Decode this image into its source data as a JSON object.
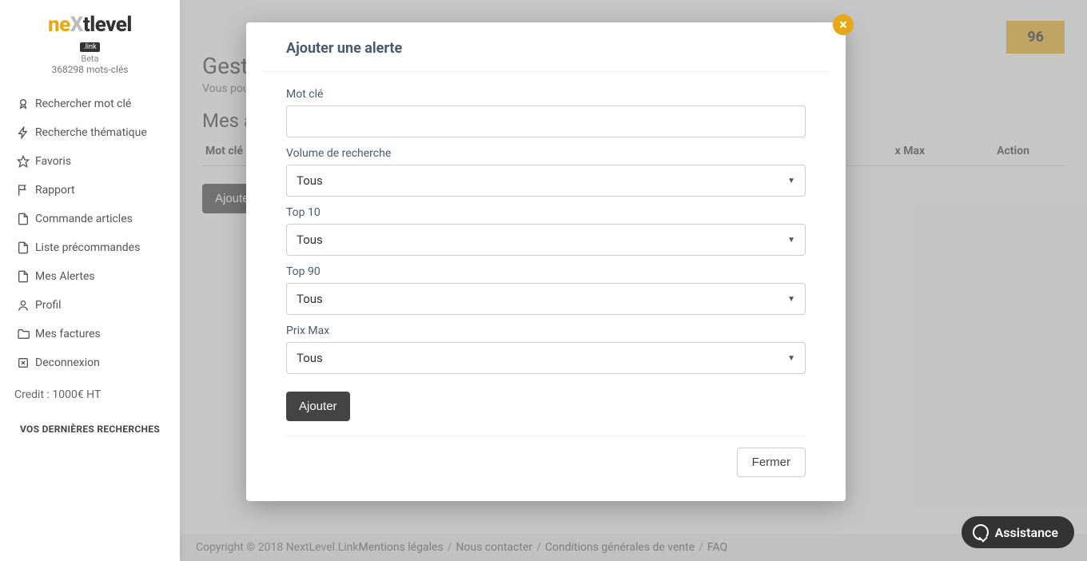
{
  "logo": {
    "part1": "ne",
    "x": "X",
    "part2": "tlevel",
    "sub": ".link"
  },
  "beta": "Beta",
  "keyword_count": "368298 mots-clés",
  "sidebar": {
    "items": [
      {
        "label": "Rechercher mot clé",
        "icon": "medal-icon"
      },
      {
        "label": "Recherche thématique",
        "icon": "bolt-icon"
      },
      {
        "label": "Favoris",
        "icon": "star-icon"
      },
      {
        "label": "Rapport",
        "icon": "flag-icon"
      },
      {
        "label": "Commande articles",
        "icon": "file-icon"
      },
      {
        "label": "Liste précommandes",
        "icon": "file-icon"
      },
      {
        "label": "Mes Alertes",
        "icon": "file-icon"
      },
      {
        "label": "Profil",
        "icon": "user-icon"
      },
      {
        "label": "Mes factures",
        "icon": "folder-icon"
      },
      {
        "label": "Deconnexion",
        "icon": "logout-icon"
      }
    ],
    "credit": "Credit : 1000€ HT",
    "recent_title": "VOS DERNIÈRES RECHERCHES"
  },
  "banner_right": "96",
  "page": {
    "title": "Gest",
    "sub": "Vous pouv",
    "alerts_title": "Mes a"
  },
  "table": {
    "col1": "Mot clé",
    "col_prixmax": "x Max",
    "col_action": "Action"
  },
  "add_button": "Ajouter",
  "modal": {
    "title": "Ajouter une alerte",
    "keyword_label": "Mot clé",
    "keyword_value": "",
    "volume_label": "Volume de recherche",
    "volume_value": "Tous",
    "top10_label": "Top 10",
    "top10_value": "Tous",
    "top90_label": "Top 90",
    "top90_value": "Tous",
    "prixmax_label": "Prix Max",
    "prixmax_value": "Tous",
    "submit": "Ajouter",
    "close": "Fermer"
  },
  "footer": {
    "copyright": "Copyright © 2018 NextLevel.Link ",
    "links": [
      "Mentions légales",
      "Nous contacter",
      "Conditions générales de vente",
      "FAQ"
    ]
  },
  "assist": "Assistance"
}
